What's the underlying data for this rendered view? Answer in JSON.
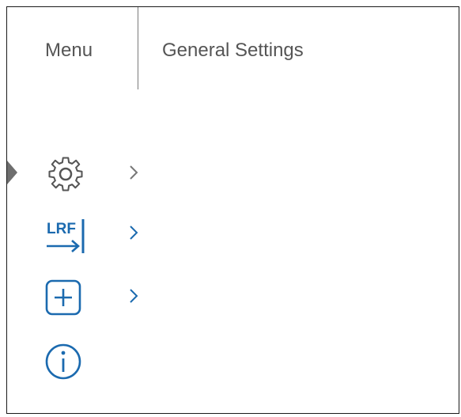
{
  "header": {
    "menu_label": "Menu",
    "title": "General Settings"
  },
  "menu": {
    "items": [
      {
        "name": "settings",
        "icon": "gear-icon",
        "has_submenu": true,
        "selected": true
      },
      {
        "name": "lrf",
        "icon": "lrf-icon",
        "icon_text": "LRF",
        "has_submenu": true,
        "selected": false
      },
      {
        "name": "add",
        "icon": "plus-box-icon",
        "has_submenu": true,
        "selected": false
      },
      {
        "name": "info",
        "icon": "info-icon",
        "has_submenu": false,
        "selected": false
      }
    ]
  },
  "colors": {
    "gear": "#555555",
    "accent": "#1b6aaf",
    "chevron_selected": "#777777",
    "chevron": "#1b6aaf",
    "text": "#555555"
  }
}
